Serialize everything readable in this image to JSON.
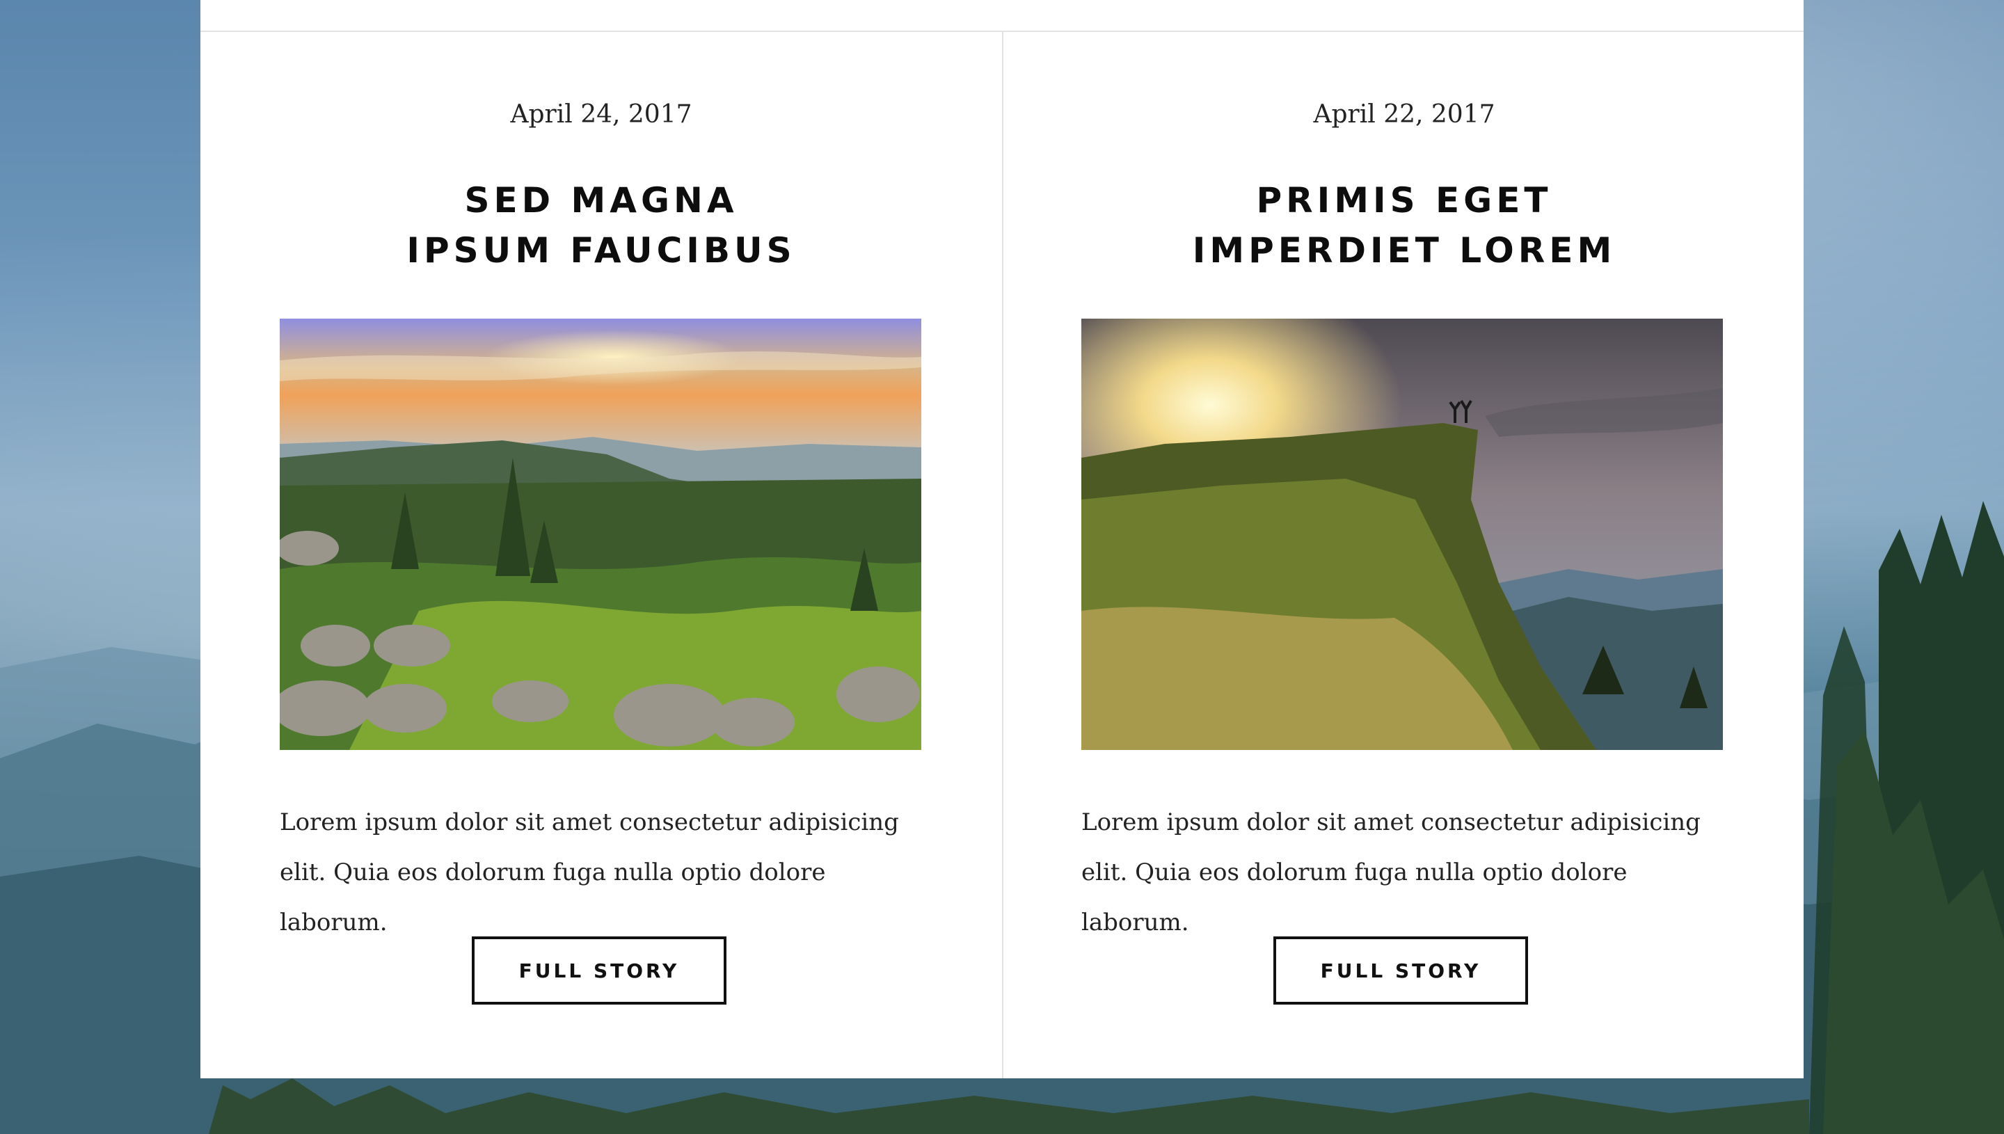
{
  "posts": [
    {
      "date": "April 24, 2017",
      "title": "SED MAGNA\nIPSUM FAUCIBUS",
      "excerpt": "Lorem ipsum dolor sit amet consectetur adipisicing elit. Quia eos dolorum fuga nulla optio dolore laborum.",
      "button_label": "FULL STORY"
    },
    {
      "date": "April 22, 2017",
      "title": "PRIMIS EGET\nIMPERDIET LOREM",
      "excerpt": "Lorem ipsum dolor sit amet consectetur adipisicing elit. Quia eos dolorum fuga nulla optio dolore laborum.",
      "button_label": "FULL STORY"
    }
  ],
  "colors": {
    "panel_background": "#ffffff",
    "divider": "#e3e3e3",
    "text": "#222222",
    "button_border": "#111111"
  }
}
